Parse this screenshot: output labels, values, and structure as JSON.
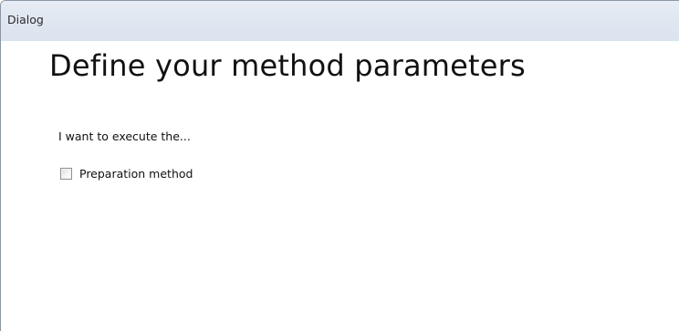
{
  "window": {
    "title": "Dialog"
  },
  "main": {
    "heading": "Define your method parameters",
    "prompt": "I want to execute the...",
    "options": [
      {
        "label": "Preparation method",
        "checked": false
      }
    ]
  }
}
